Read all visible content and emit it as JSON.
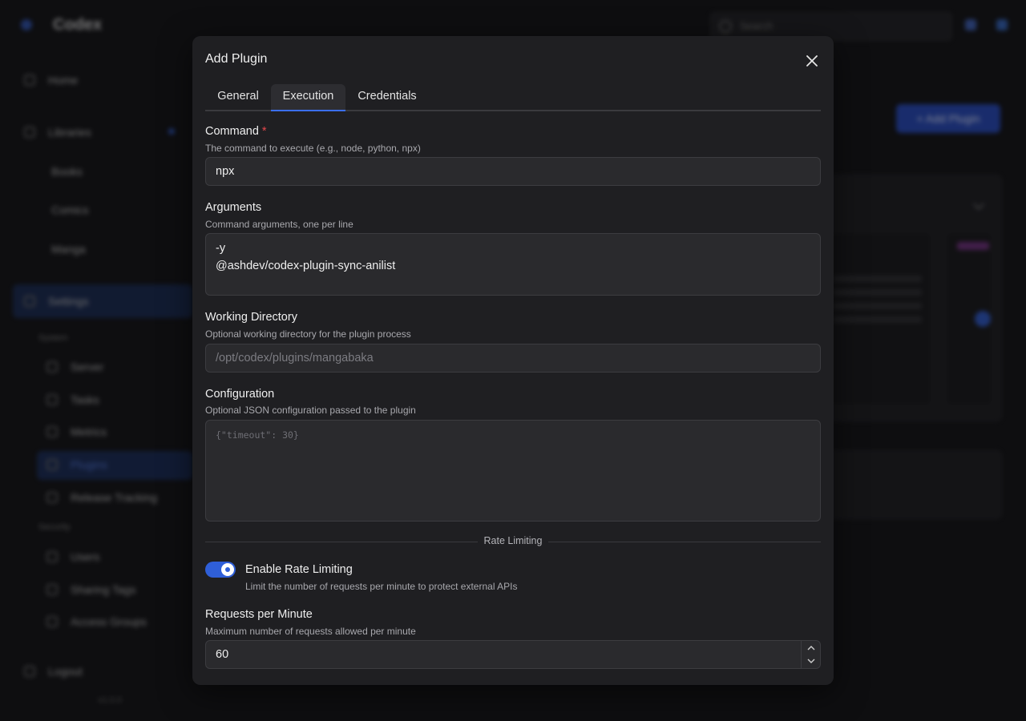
{
  "background": {
    "app_title": "Codex",
    "search_placeholder": "Search",
    "sidebar": {
      "home": "Home",
      "libraries": "Libraries",
      "books": "Books",
      "comics": "Comics",
      "manga": "Manga",
      "settings": "Settings",
      "section_system": "System",
      "server": "Server",
      "tasks": "Tasks",
      "metrics": "Metrics",
      "plugins": "Plugins",
      "release_tracking": "Release Tracking",
      "section_security": "Security",
      "users": "Users",
      "sharing_tags": "Sharing Tags",
      "access_groups": "Access Groups",
      "logout": "Logout",
      "version": "v1.0.0"
    },
    "main": {
      "add_plugin_button": "+ Add Plugin"
    }
  },
  "modal": {
    "title": "Add Plugin",
    "tabs": [
      {
        "label": "General"
      },
      {
        "label": "Execution"
      },
      {
        "label": "Credentials"
      }
    ],
    "active_tab": "Execution",
    "command": {
      "label": "Command",
      "required_mark": "*",
      "description": "The command to execute (e.g., node, python, npx)",
      "value": "npx"
    },
    "arguments": {
      "label": "Arguments",
      "description": "Command arguments, one per line",
      "value": "-y\n@ashdev/codex-plugin-sync-anilist"
    },
    "working_directory": {
      "label": "Working Directory",
      "description": "Optional working directory for the plugin process",
      "placeholder": "/opt/codex/plugins/mangabaka"
    },
    "configuration": {
      "label": "Configuration",
      "description": "Optional JSON configuration passed to the plugin",
      "placeholder": "{\"timeout\": 30}"
    },
    "rate_limiting_divider": "Rate Limiting",
    "enable_rate_limiting": {
      "label": "Enable Rate Limiting",
      "description": "Limit the number of requests per minute to protect external APIs",
      "enabled": true
    },
    "requests_per_minute": {
      "label": "Requests per Minute",
      "description": "Maximum number of requests allowed per minute",
      "value": "60"
    }
  },
  "colors": {
    "accent": "#2f5fd8",
    "required": "#e5484d",
    "modal_bg": "#1f1f22"
  }
}
